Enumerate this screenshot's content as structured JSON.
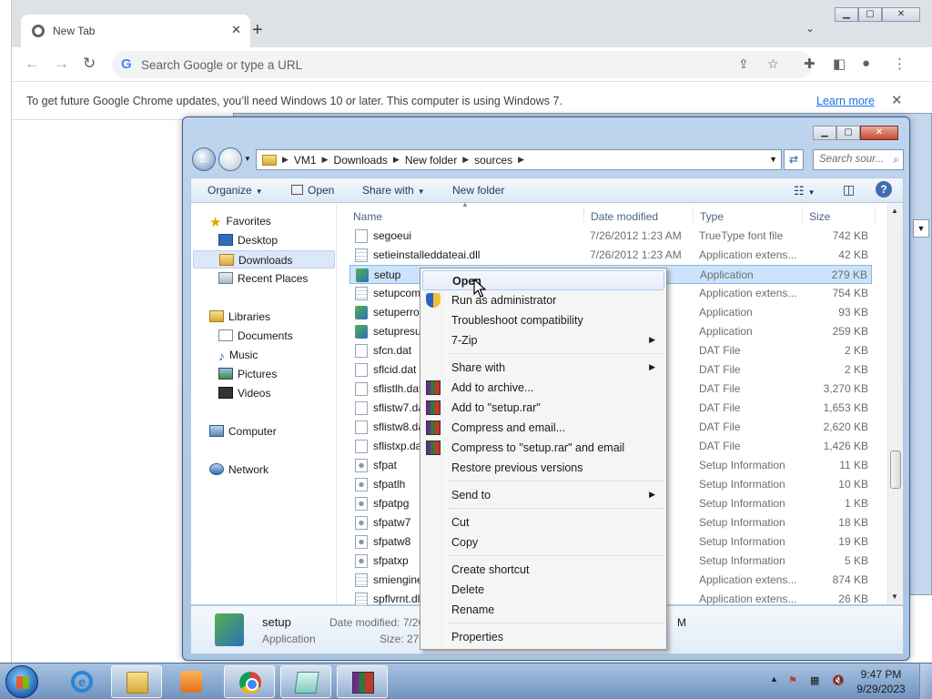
{
  "chrome": {
    "tab_title": "New Tab",
    "tab_close": "✕",
    "new_tab": "+",
    "omnibox_placeholder": "Search Google or type a URL",
    "infobar_message": "To get future Google Chrome updates, you’ll need Windows 10 or later. This computer is using Windows 7.",
    "learn_more": "Learn more",
    "infobar_close": "✕"
  },
  "explorer": {
    "breadcrumbs": [
      "VM1",
      "Downloads",
      "New folder",
      "sources"
    ],
    "search_placeholder": "Search sour...",
    "toolbar": {
      "organize": "Organize",
      "open": "Open",
      "share_with": "Share with",
      "new_folder": "New folder"
    },
    "nav": {
      "favorites": "Favorites",
      "desktop": "Desktop",
      "downloads": "Downloads",
      "recent_places": "Recent Places",
      "libraries": "Libraries",
      "documents": "Documents",
      "music": "Music",
      "pictures": "Pictures",
      "videos": "Videos",
      "computer": "Computer",
      "network": "Network"
    },
    "columns": {
      "name": "Name",
      "date_modified": "Date modified",
      "type": "Type",
      "size": "Size"
    },
    "files": [
      {
        "name": "segoeui",
        "date": "7/26/2012 1:23 AM",
        "type": "TrueType font file",
        "size": "742 KB",
        "icon": "font"
      },
      {
        "name": "setieinstalleddateai.dll",
        "date": "7/26/2012 1:23 AM",
        "type": "Application extens...",
        "size": "42 KB",
        "icon": "dll"
      },
      {
        "name": "setup",
        "date": "AM",
        "type": "Application",
        "size": "279 KB",
        "icon": "app"
      },
      {
        "name": "setupcom",
        "date": "AM",
        "type": "Application extens...",
        "size": "754 KB",
        "icon": "dll"
      },
      {
        "name": "setuperror",
        "date": "AM",
        "type": "Application",
        "size": "93 KB",
        "icon": "app"
      },
      {
        "name": "setupresu",
        "date": "AM",
        "type": "Application",
        "size": "259 KB",
        "icon": "app"
      },
      {
        "name": "sfcn.dat",
        "date": "AM",
        "type": "DAT File",
        "size": "2 KB",
        "icon": "blank"
      },
      {
        "name": "sflcid.dat",
        "date": "AM",
        "type": "DAT File",
        "size": "2 KB",
        "icon": "blank"
      },
      {
        "name": "sflistlh.dat",
        "date": "AM",
        "type": "DAT File",
        "size": "3,270 KB",
        "icon": "blank"
      },
      {
        "name": "sflistw7.da",
        "date": "AM",
        "type": "DAT File",
        "size": "1,653 KB",
        "icon": "blank"
      },
      {
        "name": "sflistw8.da",
        "date": "AM",
        "type": "DAT File",
        "size": "2,620 KB",
        "icon": "blank"
      },
      {
        "name": "sflistxp.dat",
        "date": "AM",
        "type": "DAT File",
        "size": "1,426 KB",
        "icon": "blank"
      },
      {
        "name": "sfpat",
        "date": "AM",
        "type": "Setup Information",
        "size": "11 KB",
        "icon": "inf"
      },
      {
        "name": "sfpatlh",
        "date": "AM",
        "type": "Setup Information",
        "size": "10 KB",
        "icon": "inf"
      },
      {
        "name": "sfpatpg",
        "date": "AM",
        "type": "Setup Information",
        "size": "1 KB",
        "icon": "inf"
      },
      {
        "name": "sfpatw7",
        "date": "AM",
        "type": "Setup Information",
        "size": "18 KB",
        "icon": "inf"
      },
      {
        "name": "sfpatw8",
        "date": "AM",
        "type": "Setup Information",
        "size": "19 KB",
        "icon": "inf"
      },
      {
        "name": "sfpatxp",
        "date": "AM",
        "type": "Setup Information",
        "size": "5 KB",
        "icon": "inf"
      },
      {
        "name": "smiengine",
        "date": "AM",
        "type": "Application extens...",
        "size": "874 KB",
        "icon": "dll"
      },
      {
        "name": "spflvrnt.dll",
        "date": "AM",
        "type": "Application extens...",
        "size": "26 KB",
        "icon": "dll"
      }
    ],
    "selected_index": 2,
    "details": {
      "name": "setup",
      "type": "Application",
      "date_label": "Date modified: 7/26/",
      "size_label": "Size: 278 K",
      "trail": "M"
    }
  },
  "context_menu": {
    "items": [
      {
        "label": "Open",
        "default": true,
        "highlighted": true
      },
      {
        "label": "Run as administrator",
        "icon": "shield"
      },
      {
        "label": "Troubleshoot compatibility"
      },
      {
        "label": "7-Zip",
        "submenu": true
      },
      {
        "separator": true
      },
      {
        "label": "Share with",
        "submenu": true
      },
      {
        "label": "Add to archive...",
        "icon": "rar"
      },
      {
        "label": "Add to \"setup.rar\"",
        "icon": "rar"
      },
      {
        "label": "Compress and email...",
        "icon": "rar"
      },
      {
        "label": "Compress to \"setup.rar\" and email",
        "icon": "rar"
      },
      {
        "label": "Restore previous versions"
      },
      {
        "separator": true
      },
      {
        "label": "Send to",
        "submenu": true
      },
      {
        "separator": true
      },
      {
        "label": "Cut"
      },
      {
        "label": "Copy"
      },
      {
        "separator": true
      },
      {
        "label": "Create shortcut"
      },
      {
        "label": "Delete"
      },
      {
        "label": "Rename"
      },
      {
        "separator": true
      },
      {
        "label": "Properties"
      }
    ]
  },
  "taskbar": {
    "time": "9:47 PM",
    "date": "9/29/2023"
  }
}
